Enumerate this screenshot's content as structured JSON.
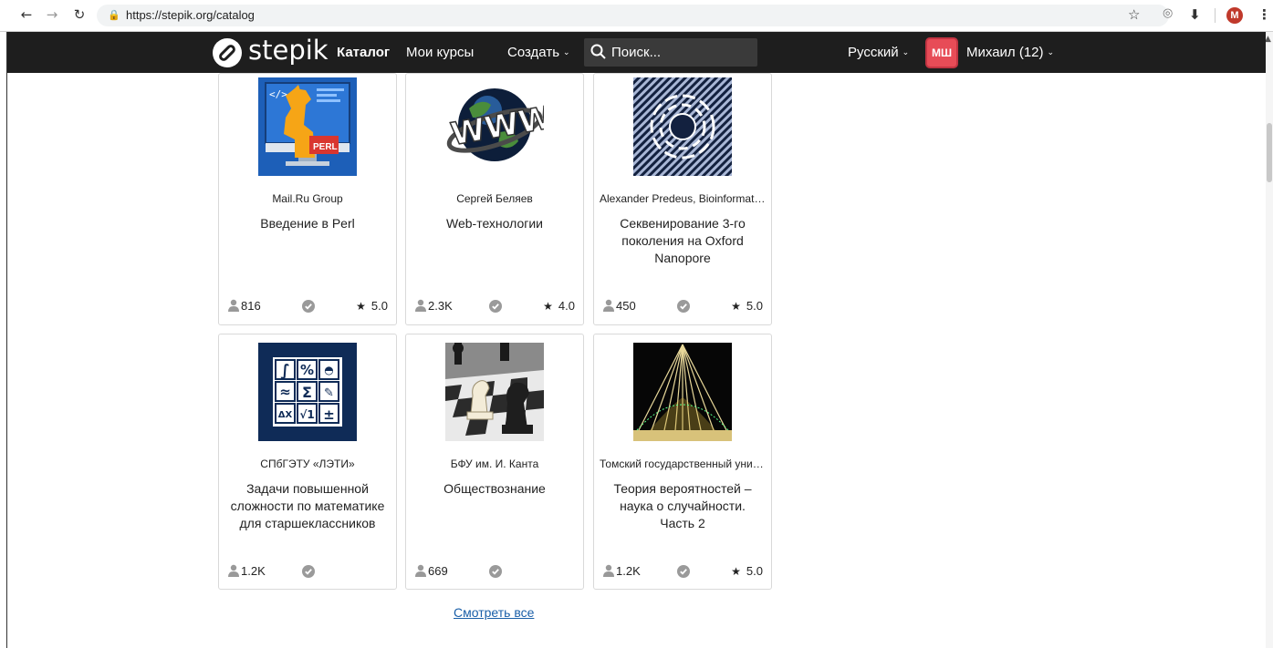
{
  "browser": {
    "url": "https://stepik.org/catalog",
    "profile_initial": "M"
  },
  "navbar": {
    "logo_text": "stepik",
    "catalog": "Каталог",
    "my_courses": "Мои курсы",
    "create": "Создать",
    "search_placeholder": "Поиск...",
    "language": "Русский",
    "avatar_initials": "МШ",
    "user": "Михаил (12)"
  },
  "colors": {
    "navbar_bg": "#1e1e1e",
    "avatar_bg": "#e74c57",
    "link": "#1a5fa8"
  },
  "courses": [
    {
      "org": "Mail.Ru Group",
      "title": "Введение в Perl",
      "learners": "816",
      "rating": "5.0",
      "icon": "perl-camel-icon"
    },
    {
      "org": "Сергей Беляев",
      "title": "Web-технологии",
      "learners": "2.3K",
      "rating": "4.0",
      "icon": "www-globe-icon"
    },
    {
      "org": "Alexander Predeus,  Bioinformatics Institute",
      "title": "Секвенирование 3-го поколения на Oxford Nanopore",
      "learners": "450",
      "rating": "5.0",
      "icon": "spiral-pattern-icon"
    },
    {
      "org": "СПбГЭТУ «ЛЭТИ»",
      "title": "Задачи повышенной сложности по математике для старшеклассников",
      "learners": "1.2K",
      "rating": "",
      "icon": "math-symbols-icon"
    },
    {
      "org": "БФУ им. И. Канта",
      "title": "Обществознание",
      "learners": "669",
      "rating": "",
      "icon": "chess-icon"
    },
    {
      "org": "Томский государственный университет",
      "title": "Теория вероятностей – наука о случайности. Часть 2",
      "learners": "1.2K",
      "rating": "5.0",
      "icon": "galton-board-icon"
    }
  ],
  "see_all": "Смотреть все"
}
